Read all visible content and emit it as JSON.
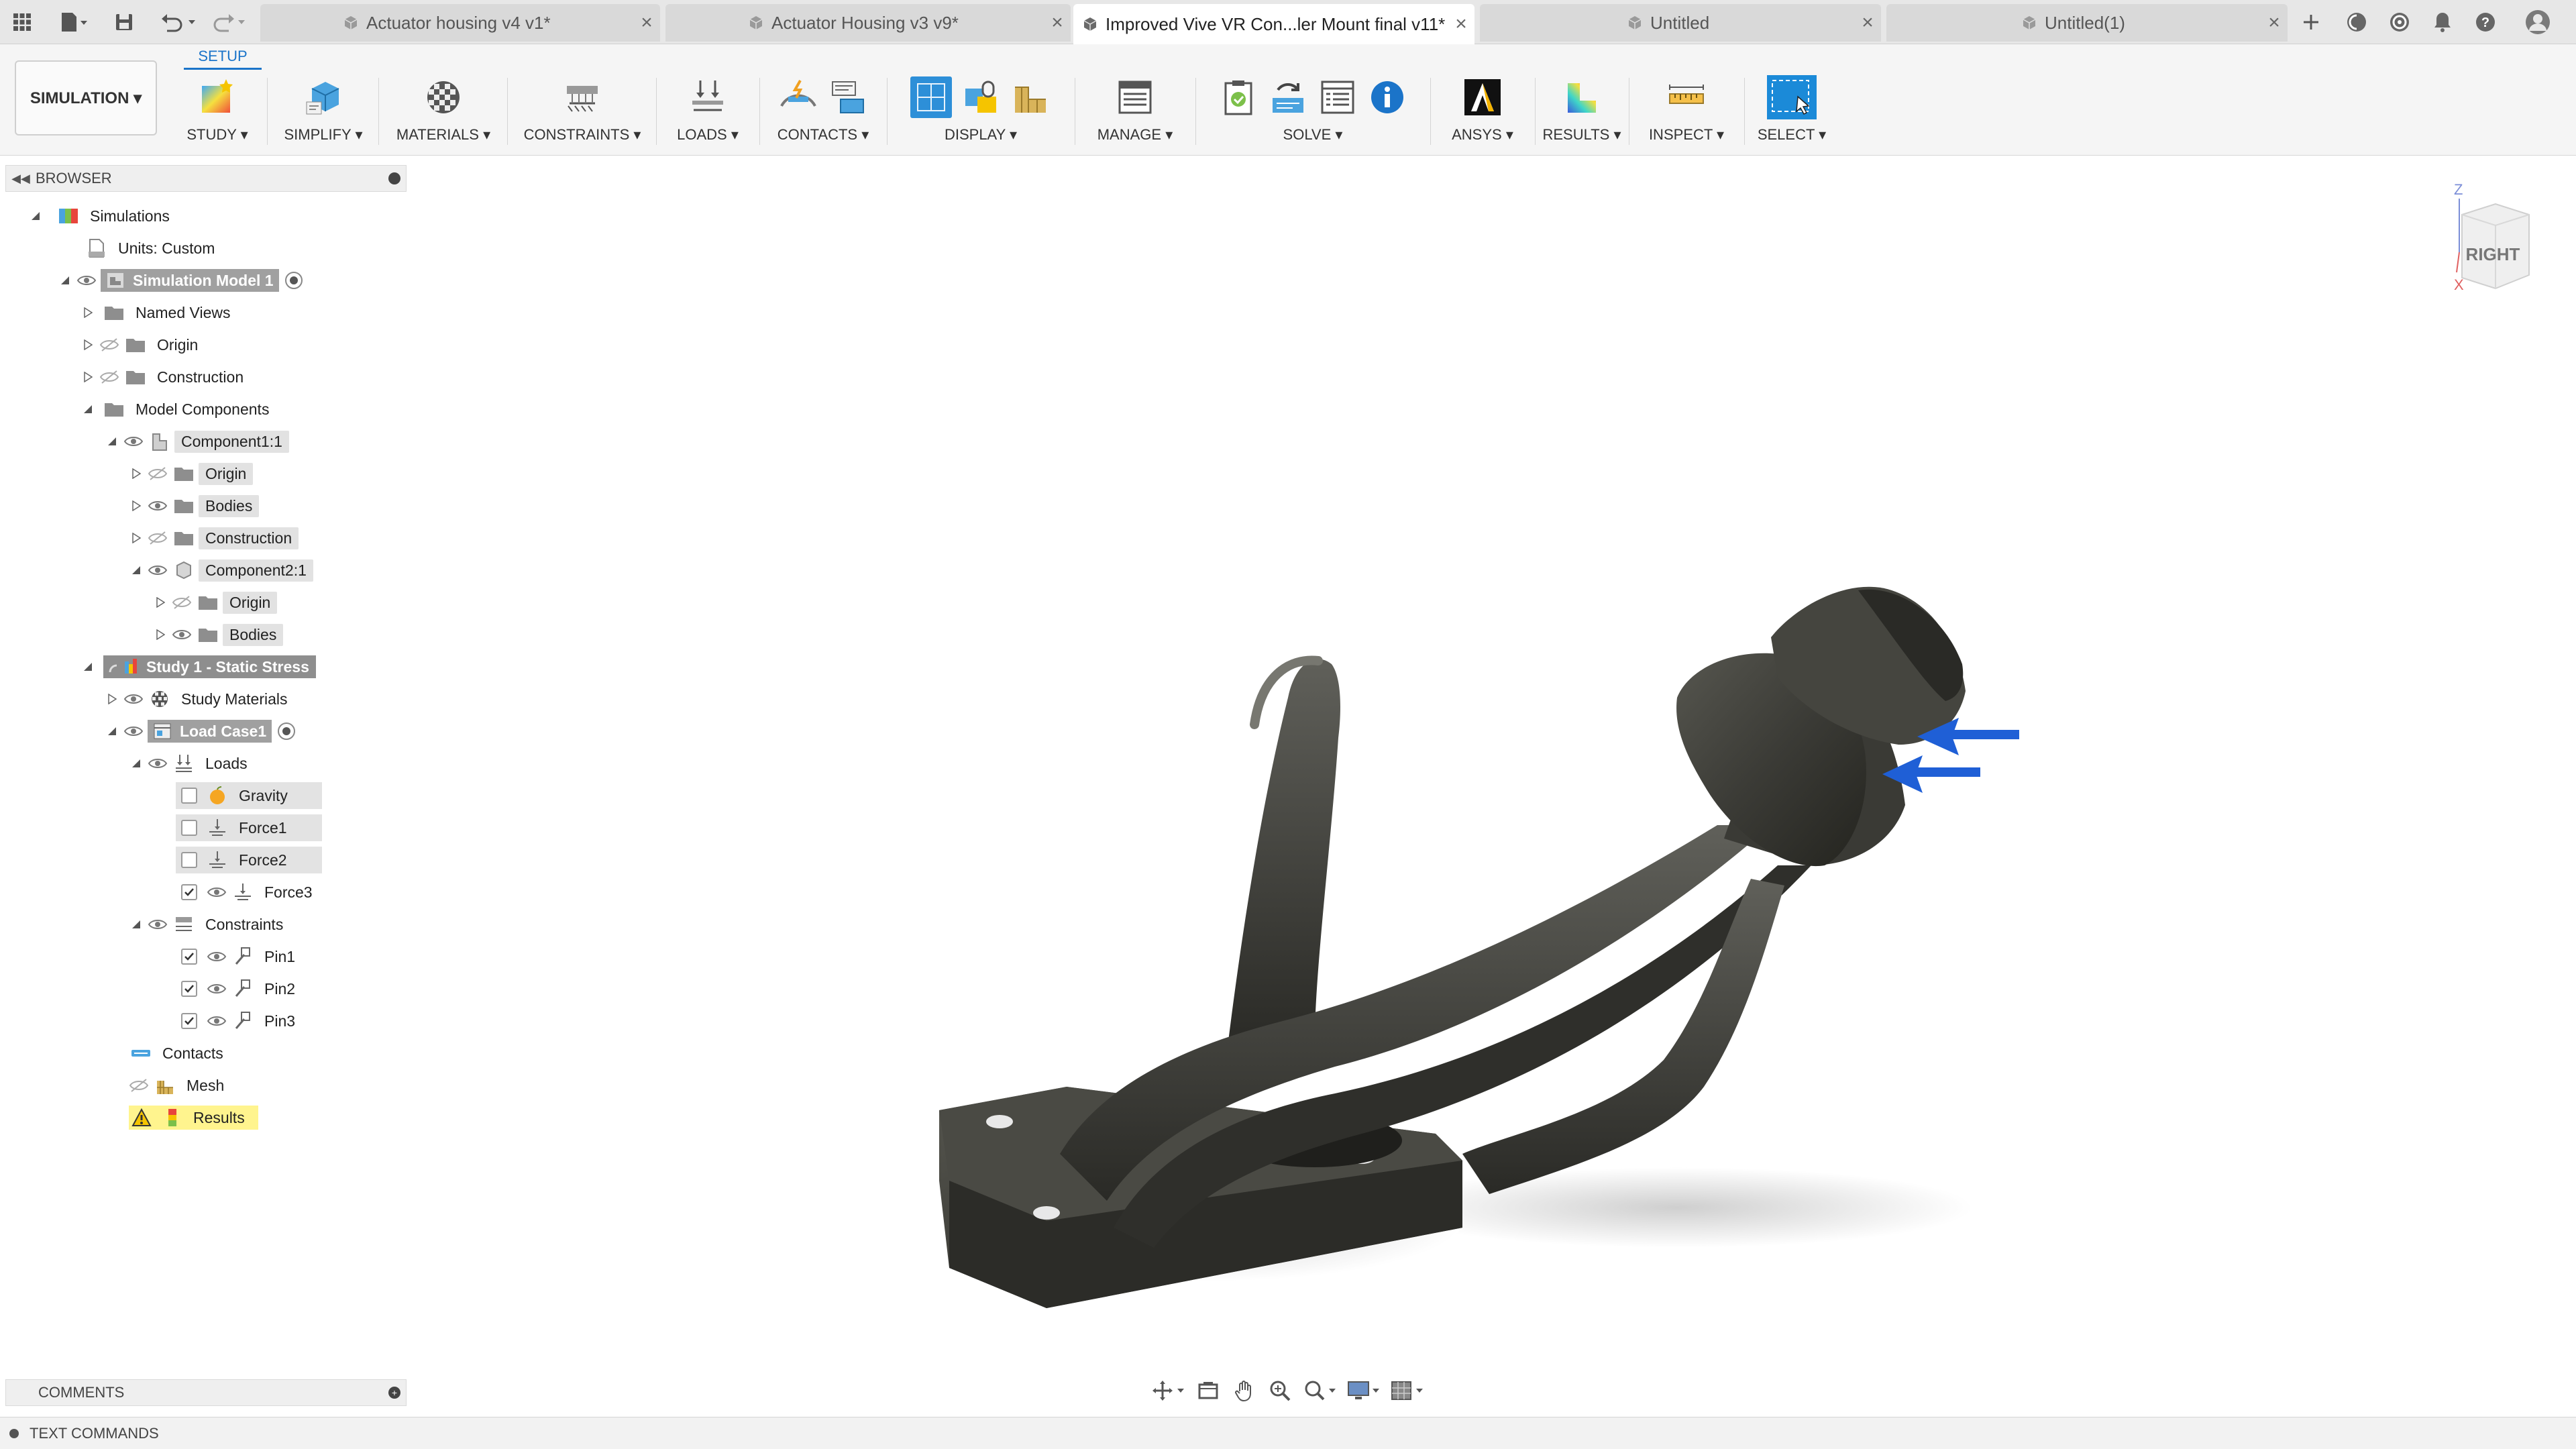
{
  "tabs": [
    {
      "label": "Actuator housing v4 v1*",
      "active": false
    },
    {
      "label": "Actuator Housing v3 v9*",
      "active": false
    },
    {
      "label": "Improved Vive VR Con...ler Mount final v11*",
      "active": true
    },
    {
      "label": "Untitled",
      "active": false
    },
    {
      "label": "Untitled(1)",
      "active": false
    }
  ],
  "toolbar": {
    "workspace_label": "SIMULATION ▾",
    "setup_tab": "SETUP",
    "groups": {
      "study": "STUDY ▾",
      "simplify": "SIMPLIFY ▾",
      "materials": "MATERIALS ▾",
      "constraints": "CONSTRAINTS ▾",
      "loads": "LOADS ▾",
      "contacts": "CONTACTS ▾",
      "display": "DISPLAY ▾",
      "manage": "MANAGE ▾",
      "solve": "SOLVE ▾",
      "ansys": "ANSYS ▾",
      "results": "RESULTS ▾",
      "inspect": "INSPECT ▾",
      "select": "SELECT ▾"
    }
  },
  "browser": {
    "title": "BROWSER",
    "nodes": [
      {
        "label": "Simulations"
      },
      {
        "label": "Units: Custom"
      },
      {
        "label": "Simulation Model 1"
      },
      {
        "label": "Named Views"
      },
      {
        "label": "Origin"
      },
      {
        "label": "Construction"
      },
      {
        "label": "Model Components"
      },
      {
        "label": "Component1:1"
      },
      {
        "label": "Origin"
      },
      {
        "label": "Bodies"
      },
      {
        "label": "Construction"
      },
      {
        "label": "Component2:1"
      },
      {
        "label": "Origin"
      },
      {
        "label": "Bodies"
      },
      {
        "label": "Study 1 - Static Stress"
      },
      {
        "label": "Study Materials"
      },
      {
        "label": "Load Case1"
      },
      {
        "label": "Loads"
      },
      {
        "label": "Gravity"
      },
      {
        "label": "Force1"
      },
      {
        "label": "Force2"
      },
      {
        "label": "Force3"
      },
      {
        "label": "Constraints"
      },
      {
        "label": "Pin1"
      },
      {
        "label": "Pin2"
      },
      {
        "label": "Pin3"
      },
      {
        "label": "Contacts"
      },
      {
        "label": "Mesh"
      },
      {
        "label": "Results"
      }
    ]
  },
  "viewcube": {
    "face": "RIGHT",
    "axis_z": "Z",
    "axis_x": "X"
  },
  "comments_label": "COMMENTS",
  "text_commands_label": "TEXT COMMANDS",
  "colors": {
    "accent": "#1b74c9",
    "force_arrow": "#1f5fd6",
    "model": "#3b3b38",
    "results_highlight": "#fff48e"
  }
}
